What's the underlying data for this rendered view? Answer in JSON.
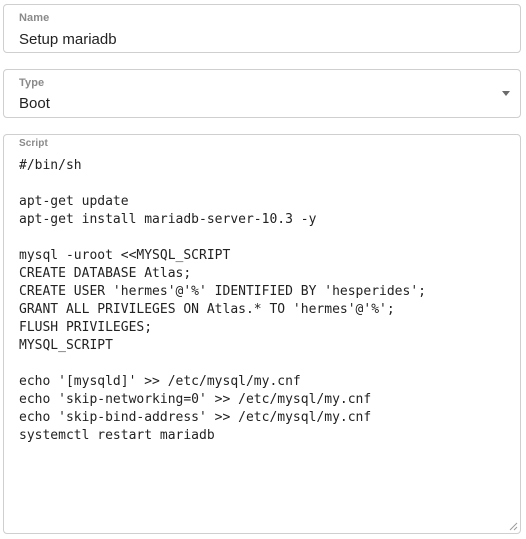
{
  "name": {
    "label": "Name",
    "value": "Setup mariadb"
  },
  "type": {
    "label": "Type",
    "value": "Boot",
    "icon": "chevron-down-icon"
  },
  "script": {
    "label": "Script",
    "value": "#/bin/sh\n\napt-get update\napt-get install mariadb-server-10.3 -y\n\nmysql -uroot <<MYSQL_SCRIPT\nCREATE DATABASE Atlas;\nCREATE USER 'hermes'@'%' IDENTIFIED BY 'hesperides';\nGRANT ALL PRIVILEGES ON Atlas.* TO 'hermes'@'%';\nFLUSH PRIVILEGES;\nMYSQL_SCRIPT\n\necho '[mysqld]' >> /etc/mysql/my.cnf\necho 'skip-networking=0' >> /etc/mysql/my.cnf\necho 'skip-bind-address' >> /etc/mysql/my.cnf\nsystemctl restart mariadb"
  }
}
